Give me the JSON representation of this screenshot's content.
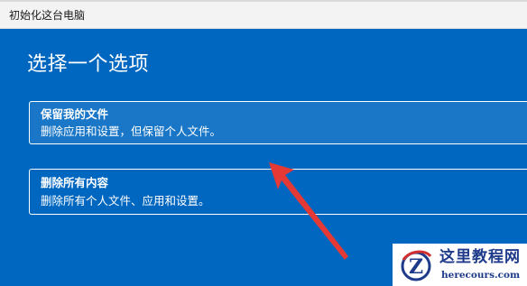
{
  "window": {
    "title": "初始化这台电脑"
  },
  "heading": "选择一个选项",
  "options": [
    {
      "title": "保留我的文件",
      "description": "删除应用和设置，但保留个人文件。"
    },
    {
      "title": "删除所有内容",
      "description": "删除所有个人文件、应用和设置。"
    }
  ],
  "watermark": {
    "title": "这里教程网",
    "url": "herecours.com"
  },
  "colors": {
    "dialog_background": "#0067c0",
    "highlighted_option": "#1a76c7",
    "annotation_arrow": "#e53935"
  }
}
